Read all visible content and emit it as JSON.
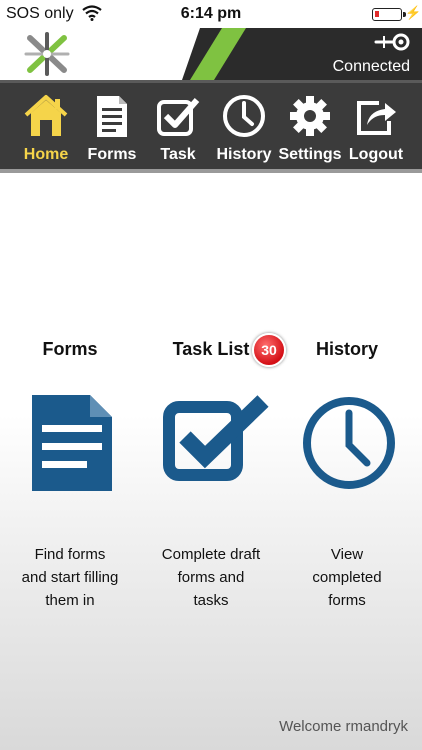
{
  "status_bar": {
    "carrier": "SOS only",
    "time": "6:14 pm",
    "wifi_icon": "wifi-icon",
    "battery_icon": "battery-low-icon",
    "battery_color": "#e02b2b"
  },
  "header": {
    "logo_icon": "app-logo-icon",
    "connection_icon": "connection-plug-icon",
    "connection_status": "Connected",
    "accent_color": "#7fc241"
  },
  "nav": {
    "items": [
      {
        "label": "Home",
        "icon": "home-icon",
        "active": true
      },
      {
        "label": "Forms",
        "icon": "document-icon",
        "active": false
      },
      {
        "label": "Task",
        "icon": "checkbox-icon",
        "active": false
      },
      {
        "label": "History",
        "icon": "clock-icon",
        "active": false
      },
      {
        "label": "Settings",
        "icon": "gear-icon",
        "active": false
      },
      {
        "label": "Logout",
        "icon": "share-icon",
        "active": false
      }
    ],
    "active_color": "#f5d44a"
  },
  "main": {
    "tiles": [
      {
        "title": "Forms",
        "icon": "document-icon",
        "description": [
          "Find forms",
          "and start filling",
          "them in"
        ]
      },
      {
        "title": "Task List",
        "icon": "checkbox-icon",
        "badge": "30",
        "description": [
          "Complete draft",
          "forms and",
          "tasks"
        ]
      },
      {
        "title": "History",
        "icon": "clock-icon",
        "description": [
          "View",
          "completed",
          "forms"
        ]
      }
    ],
    "icon_color": "#1b5a8c",
    "badge_color": "#d40f16"
  },
  "footer": {
    "welcome": "Welcome rmandryk"
  }
}
